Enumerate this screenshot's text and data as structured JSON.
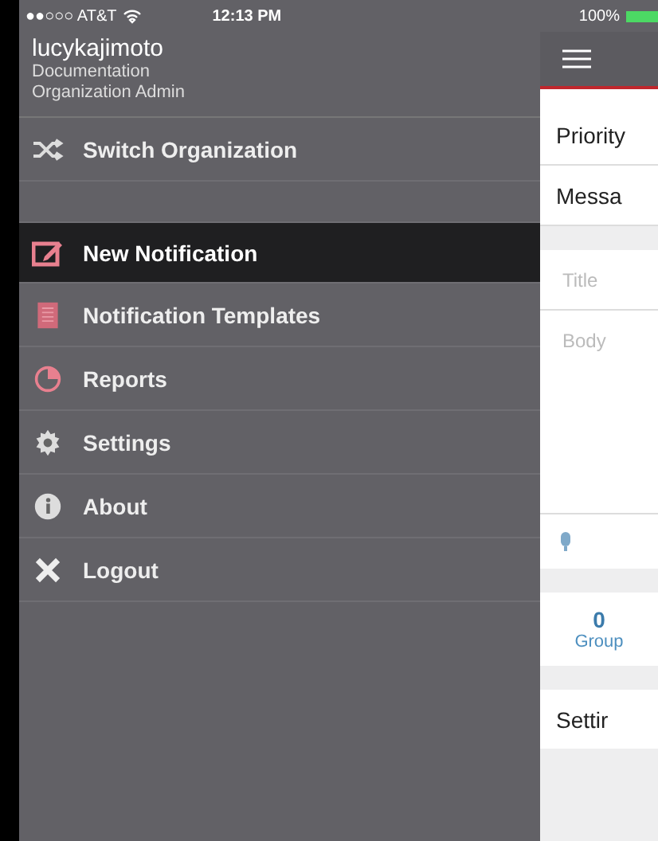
{
  "status_bar": {
    "carrier": "●●○○○ AT&T",
    "time": "12:13 PM",
    "battery": "100%"
  },
  "drawer": {
    "user": {
      "name": "lucykajimoto",
      "org": "Documentation",
      "role": "Organization Admin"
    },
    "switch": {
      "label": "Switch Organization",
      "kind": "shuffle"
    },
    "items": [
      {
        "label": "New Notification",
        "kind": "edit",
        "selected": true
      },
      {
        "label": "Notification Templates",
        "kind": "list",
        "selected": false
      },
      {
        "label": "Reports",
        "kind": "pie",
        "selected": false
      },
      {
        "label": "Settings",
        "kind": "gear",
        "selected": false
      },
      {
        "label": "About",
        "kind": "info",
        "selected": false
      },
      {
        "label": "Logout",
        "kind": "close",
        "selected": false
      }
    ]
  },
  "panel": {
    "rows": [
      "Priority",
      "Messa"
    ],
    "title_placeholder": "Title",
    "body_placeholder": "Body",
    "count": "0",
    "count_label": "Group",
    "settings": "Settir"
  }
}
